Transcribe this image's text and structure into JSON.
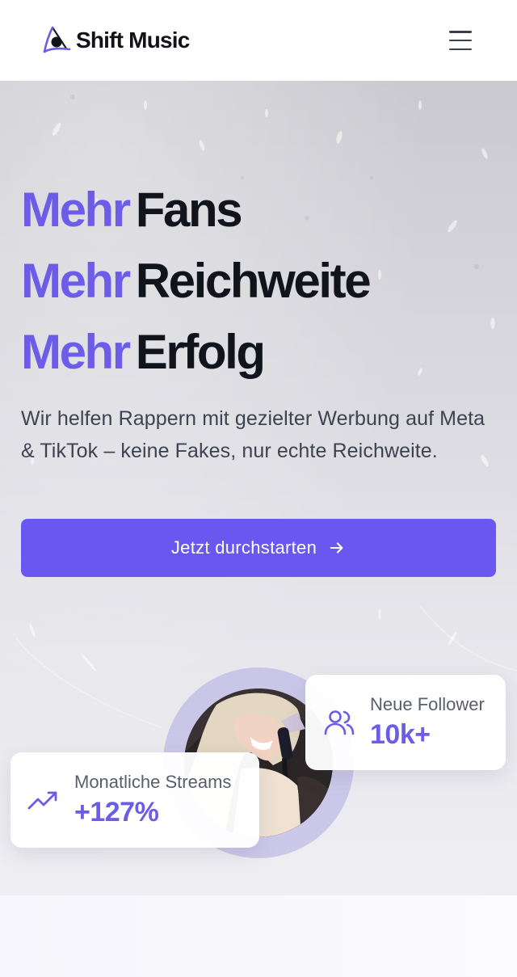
{
  "header": {
    "brand_name": "Shift Music",
    "logo_icon": "shift-music-logo-icon",
    "menu_icon": "hamburger-menu-icon"
  },
  "hero": {
    "headline": [
      {
        "accent": "Mehr",
        "word": "Fans"
      },
      {
        "accent": "Mehr",
        "word": "Reichweite"
      },
      {
        "accent": "Mehr",
        "word": "Erfolg"
      }
    ],
    "intro": "Wir helfen Rappern mit gezielter Werbung auf Meta & TikTok – keine Fakes, nur echte Reichweite.",
    "cta_label": "Jetzt durchstarten",
    "cta_icon": "arrow-right-icon"
  },
  "stats": {
    "followers": {
      "label": "Neue Follower",
      "value": "10k+",
      "icon": "users-icon"
    },
    "streams": {
      "label": "Monatliche Streams",
      "value": "+127%",
      "icon": "trending-up-icon"
    }
  },
  "colors": {
    "accent": "#6c5ce7",
    "button": "#6957f0",
    "headline_dark": "#12141c"
  }
}
